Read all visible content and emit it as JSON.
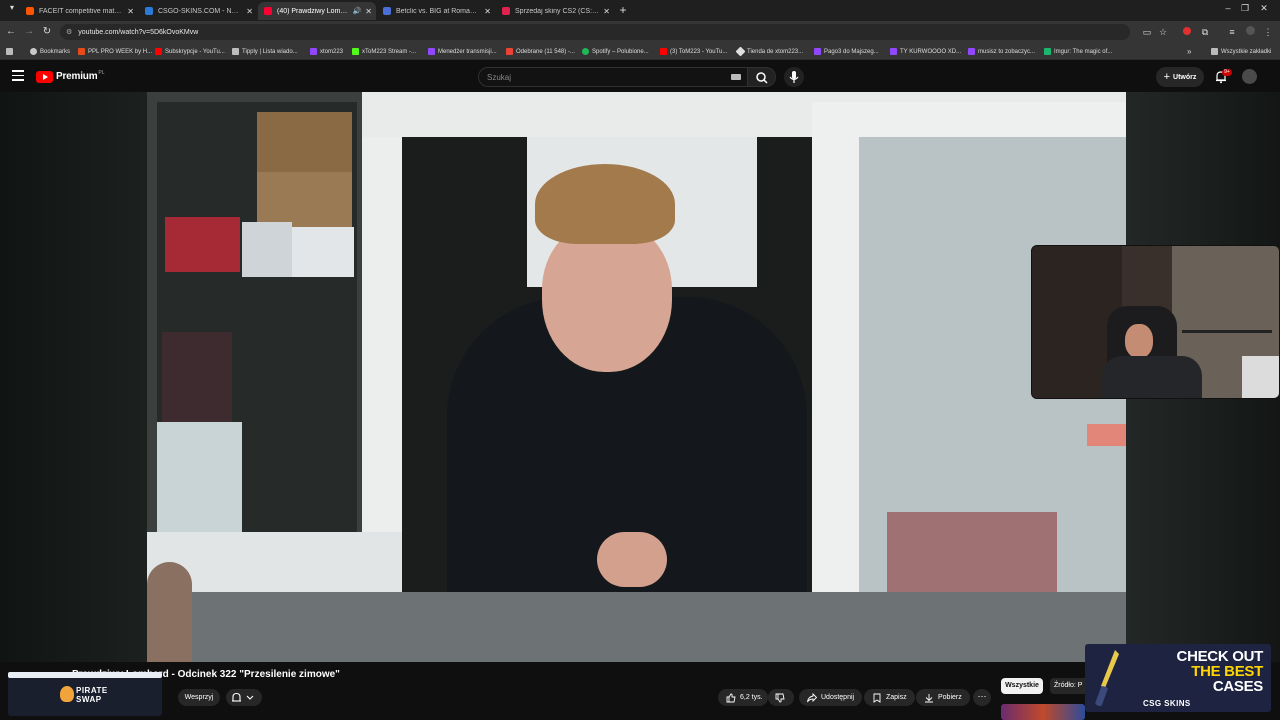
{
  "browser": {
    "tabs": [
      {
        "title": "FACEIT competitive match - FAC",
        "color": "#ff5500",
        "active": false,
        "audio": false
      },
      {
        "title": "CSGO-SKINS.COM - Najlepsze",
        "color": "#2a7bd5",
        "active": false,
        "audio": false
      },
      {
        "title": "(40) Prawdziwy Lombard -",
        "color": "#ff0033",
        "active": true,
        "audio": true
      },
      {
        "title": "Betclic vs. BIG at Roman Imperi",
        "color": "#4a6fd6",
        "active": false,
        "audio": false
      },
      {
        "title": "Sprzedaj skiny CS2 (CS:GO) | Na",
        "color": "#e0234e",
        "active": false,
        "audio": false
      }
    ],
    "url": "youtube.com/watch?v=5D6kOvoKMvw",
    "bookmarks": [
      {
        "label": "Bookmarks",
        "color": "#c9c9c9"
      },
      {
        "label": "PPL PRO WEEK by H...",
        "color": "#e64a19"
      },
      {
        "label": "Subskrypcje - YouTu...",
        "color": "#ff0000"
      },
      {
        "label": "Tipply | Lista wiado...",
        "color": "#bdbdbd"
      },
      {
        "label": "xtom223",
        "color": "#9146ff"
      },
      {
        "label": "xToM223 Stream -...",
        "color": "#53fc18"
      },
      {
        "label": "Menedżer transmisji...",
        "color": "#9146ff"
      },
      {
        "label": "Odebrane (11 548) -...",
        "color": "#ea4335"
      },
      {
        "label": "Spotify – Polubione...",
        "color": "#1db954"
      },
      {
        "label": "(3) ToM223 - YouTu...",
        "color": "#ff0000"
      },
      {
        "label": "Tienda de xtom223...",
        "color": "#e0e0e0"
      },
      {
        "label": "Pago3 do Majszeg...",
        "color": "#9146ff"
      },
      {
        "label": "TY KURWOOOO XD...",
        "color": "#9146ff"
      },
      {
        "label": "musisz to zobaczyc...",
        "color": "#9146ff"
      },
      {
        "label": "Imgur: The magic of...",
        "color": "#1bb76e"
      }
    ],
    "all_bookmarks": "Wszystkie zakładki",
    "more_bookmarks": "»"
  },
  "youtube": {
    "logo_text": "Premium",
    "logo_country": "PL",
    "search_placeholder": "Szukaj",
    "create_label": "Utwórz",
    "notifications_badge": "9+",
    "video_title": "Prawdziwy Lombard - Odcinek 322 \"Przesilenie zimowe\"",
    "support_label": "Wesprzyj",
    "likes": "6,2 tys.",
    "share_label": "Udostępnij",
    "save_label": "Zapisz",
    "download_label": "Pobierz",
    "more_label": "⋯",
    "chip_all": "Wszystkie",
    "chip_source": "Źródło: P",
    "sponsor_line1": "PIRATE",
    "sponsor_line2": "SWAP",
    "promo_line1": "CHECK OUT",
    "promo_line2": "THE BEST",
    "promo_line3": "CASES",
    "promo_brand": "CSG SKINS",
    "webcam_label": "webcam overlay"
  },
  "icons": {
    "menu": "hamburger-icon",
    "search": "search-icon",
    "mic": "mic-icon",
    "bell": "bell-icon",
    "like": "thumbs-up-icon",
    "dislike": "thumbs-down-icon",
    "share": "share-icon",
    "save": "bookmark-icon",
    "download": "download-icon"
  }
}
